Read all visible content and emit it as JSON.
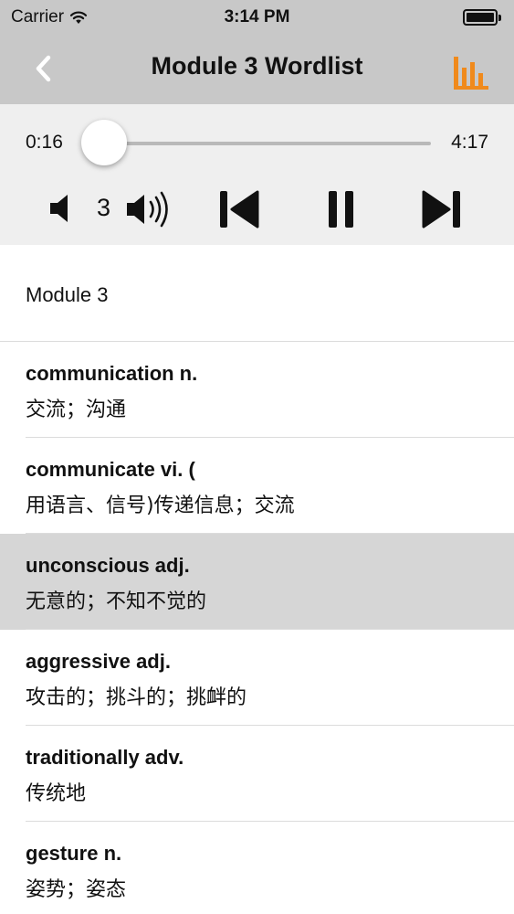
{
  "status_bar": {
    "carrier": "Carrier",
    "time": "3:14 PM"
  },
  "nav": {
    "title": "Module 3 Wordlist",
    "back_icon": "chevron-left-icon",
    "chart_icon": "bar-chart-icon",
    "accent_color": "#f08a1c"
  },
  "player": {
    "current_time": "0:16",
    "total_time": "4:17",
    "progress": 0.062,
    "progress_color": "#2f9bd8",
    "volume_level": "3"
  },
  "list": {
    "section_title": "Module 3",
    "selected_index": 2,
    "items": [
      {
        "term": "communication n.",
        "meaning": "交流；沟通"
      },
      {
        "term": "communicate vi. (",
        "meaning": "用语言、信号)传递信息；交流"
      },
      {
        "term": "unconscious adj.",
        "meaning": "无意的；不知不觉的"
      },
      {
        "term": "aggressive adj.",
        "meaning": "攻击的；挑斗的；挑衅的"
      },
      {
        "term": "traditionally adv.",
        "meaning": "传统地"
      },
      {
        "term": "gesture n.",
        "meaning": "姿势；姿态"
      }
    ]
  }
}
